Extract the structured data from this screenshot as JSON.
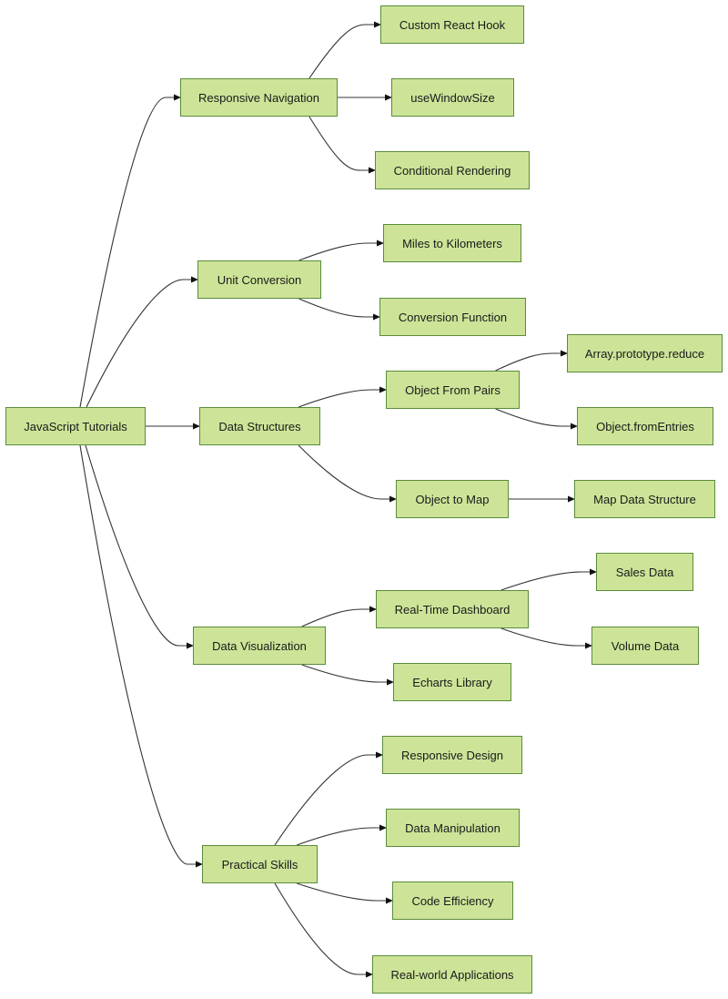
{
  "diagram": {
    "type": "mindmap",
    "colors": {
      "node_fill": "#cde498",
      "node_border": "#5b8c3a",
      "edge": "#333333"
    },
    "nodes": [
      {
        "id": "root",
        "label": "JavaScript Tutorials"
      },
      {
        "id": "nav",
        "label": "Responsive Navigation"
      },
      {
        "id": "hook",
        "label": "Custom React Hook"
      },
      {
        "id": "ws",
        "label": "useWindowSize"
      },
      {
        "id": "cond",
        "label": "Conditional Rendering"
      },
      {
        "id": "unit",
        "label": "Unit Conversion"
      },
      {
        "id": "miles",
        "label": "Miles to Kilometers"
      },
      {
        "id": "convfn",
        "label": "Conversion Function"
      },
      {
        "id": "ds",
        "label": "Data Structures"
      },
      {
        "id": "ofp",
        "label": "Object From Pairs"
      },
      {
        "id": "reduce",
        "label": "Array.prototype.reduce"
      },
      {
        "id": "fromentries",
        "label": "Object.fromEntries"
      },
      {
        "id": "otm",
        "label": "Object to Map"
      },
      {
        "id": "mapds",
        "label": "Map Data Structure"
      },
      {
        "id": "dv",
        "label": "Data Visualization"
      },
      {
        "id": "rtd",
        "label": "Real-Time Dashboard"
      },
      {
        "id": "sales",
        "label": "Sales Data"
      },
      {
        "id": "volume",
        "label": "Volume Data"
      },
      {
        "id": "echarts",
        "label": "Echarts Library"
      },
      {
        "id": "ps",
        "label": "Practical Skills"
      },
      {
        "id": "rd",
        "label": "Responsive Design"
      },
      {
        "id": "dm",
        "label": "Data Manipulation"
      },
      {
        "id": "ce",
        "label": "Code Efficiency"
      },
      {
        "id": "rwa",
        "label": "Real-world Applications"
      }
    ],
    "edges": [
      [
        "root",
        "nav"
      ],
      [
        "root",
        "unit"
      ],
      [
        "root",
        "ds"
      ],
      [
        "root",
        "dv"
      ],
      [
        "root",
        "ps"
      ],
      [
        "nav",
        "hook"
      ],
      [
        "nav",
        "ws"
      ],
      [
        "nav",
        "cond"
      ],
      [
        "unit",
        "miles"
      ],
      [
        "unit",
        "convfn"
      ],
      [
        "ds",
        "ofp"
      ],
      [
        "ds",
        "otm"
      ],
      [
        "ofp",
        "reduce"
      ],
      [
        "ofp",
        "fromentries"
      ],
      [
        "otm",
        "mapds"
      ],
      [
        "dv",
        "rtd"
      ],
      [
        "dv",
        "echarts"
      ],
      [
        "rtd",
        "sales"
      ],
      [
        "rtd",
        "volume"
      ],
      [
        "ps",
        "rd"
      ],
      [
        "ps",
        "dm"
      ],
      [
        "ps",
        "ce"
      ],
      [
        "ps",
        "rwa"
      ]
    ]
  }
}
